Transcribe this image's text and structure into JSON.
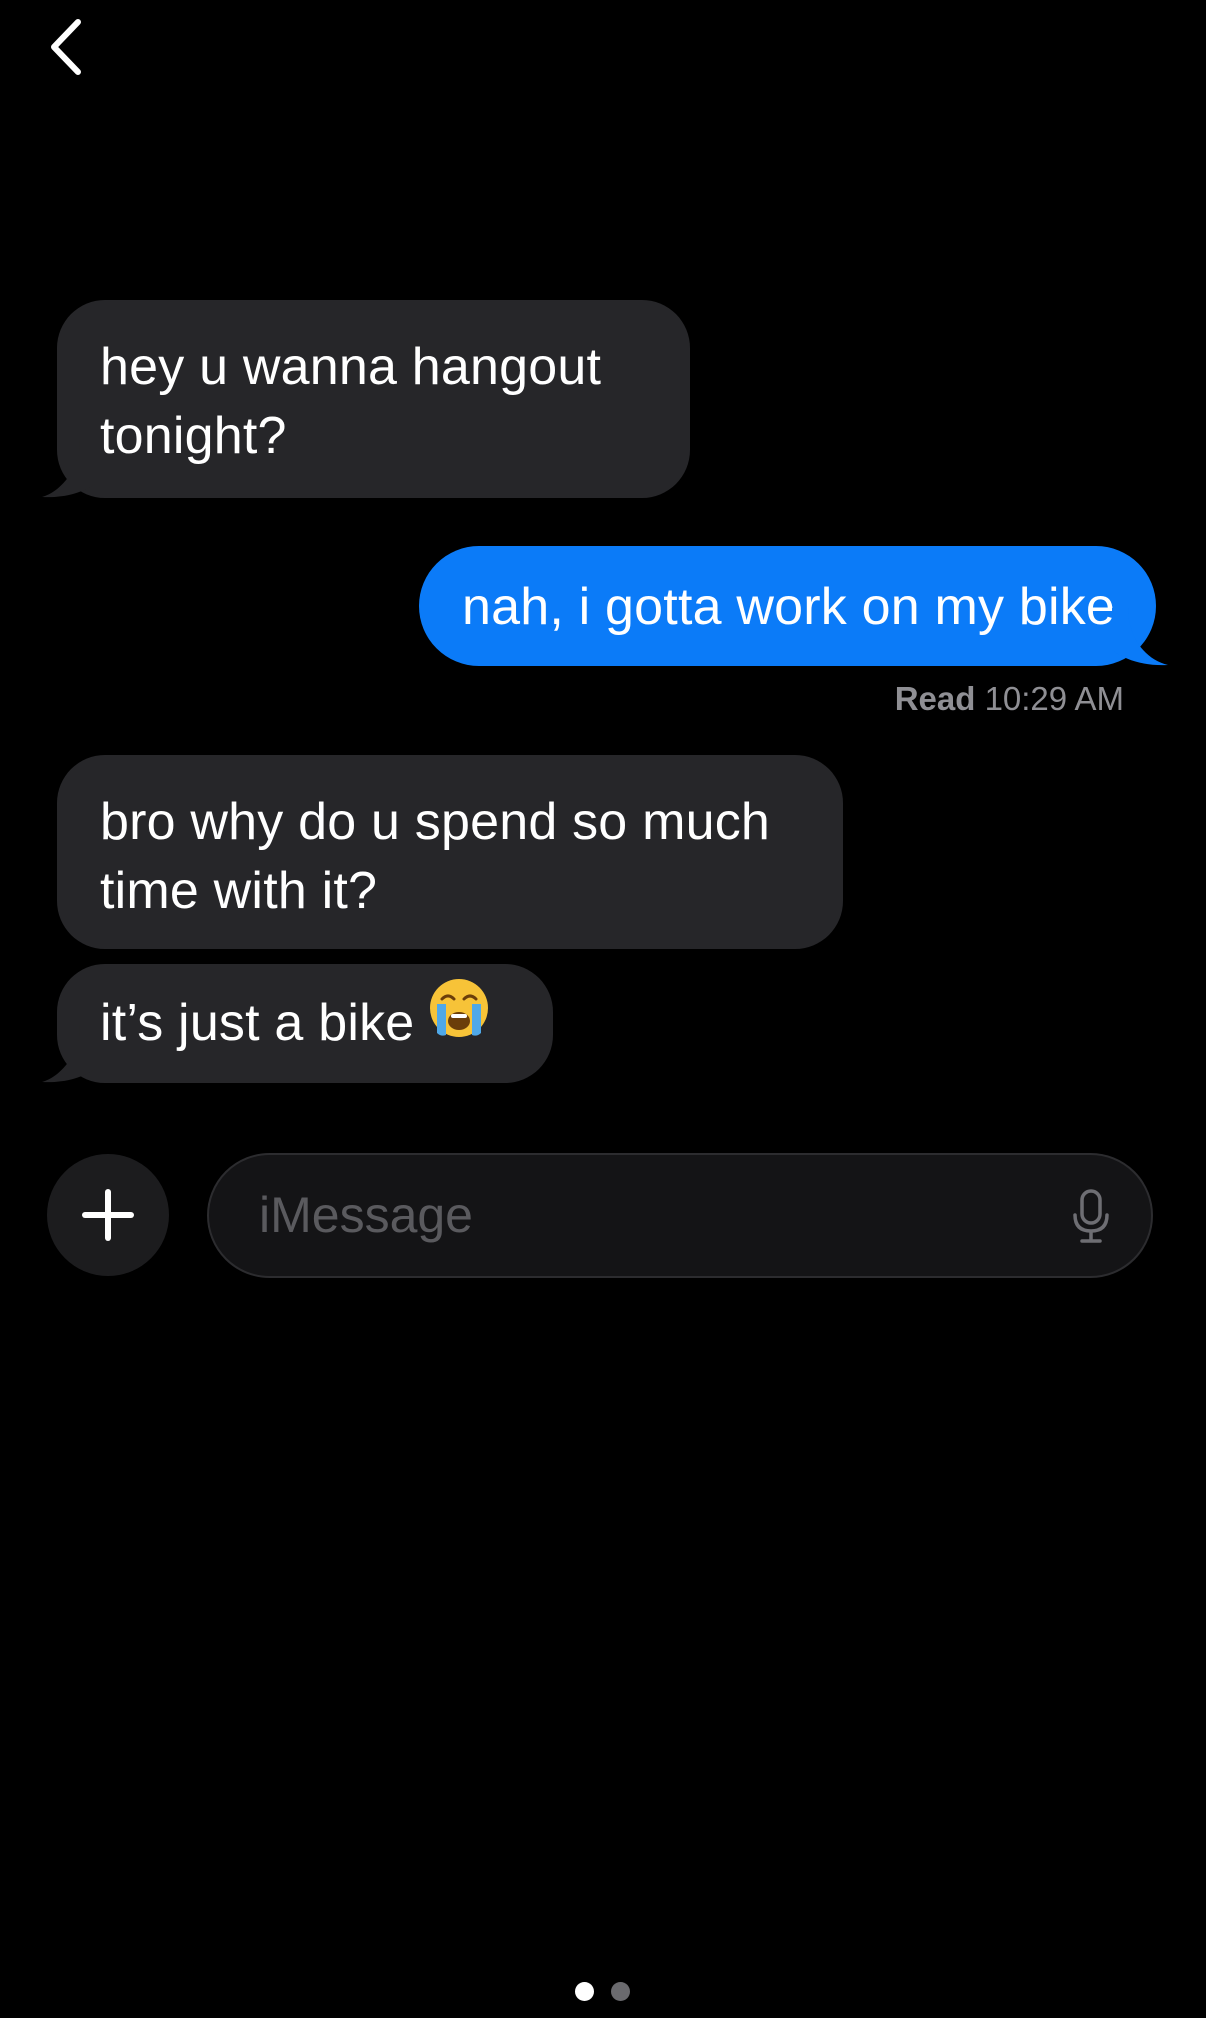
{
  "nav": {
    "back_icon": "chevron-left-icon"
  },
  "messages": [
    {
      "direction": "incoming",
      "lines": [
        "hey u wanna hangout",
        "tonight?"
      ]
    },
    {
      "direction": "outgoing",
      "text": "nah, i gotta work on my bike",
      "read_label": "Read",
      "read_time": "10:29 AM"
    },
    {
      "direction": "incoming",
      "lines": [
        "bro why do u spend so much",
        "time with it?"
      ]
    },
    {
      "direction": "incoming",
      "text": "it’s just a bike",
      "emoji": "loudly-crying-face"
    }
  ],
  "composer": {
    "add_icon": "plus-icon",
    "placeholder": "iMessage",
    "mic_icon": "microphone-icon"
  },
  "pager": {
    "count": 2,
    "active_index": 0
  },
  "colors": {
    "background": "#000000",
    "incoming_bubble": "#262629",
    "outgoing_bubble": "#0b7bf8",
    "placeholder": "#5a5a5e",
    "receipt": "#8f8f94"
  }
}
